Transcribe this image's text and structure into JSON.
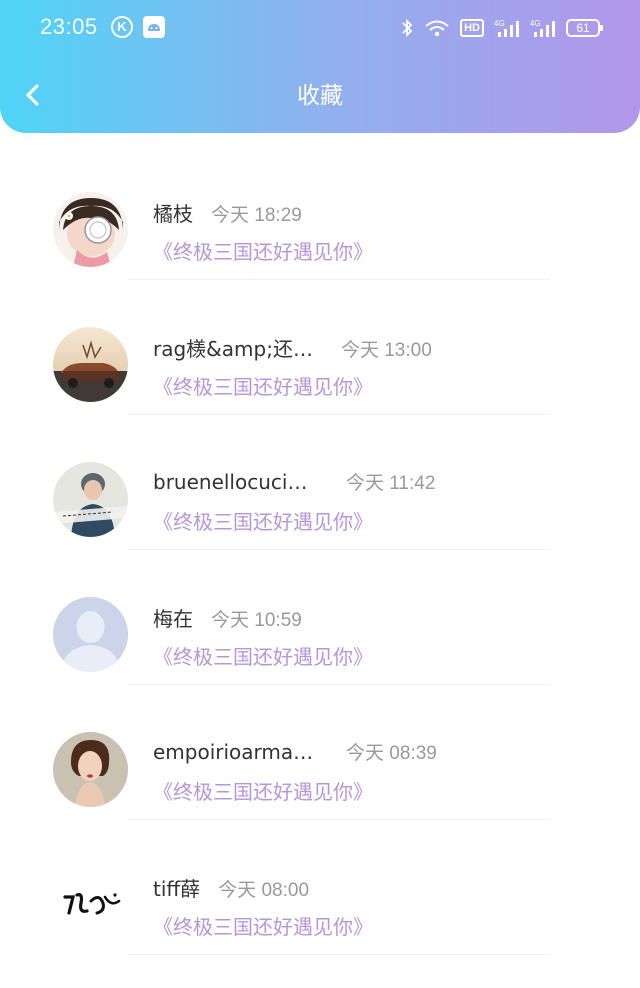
{
  "status_bar": {
    "time": "23:05",
    "k_badge": "K",
    "hd_label": "HD",
    "net1": "4G",
    "net2": "4G",
    "battery": "61"
  },
  "nav": {
    "title": "收藏",
    "back_icon": "chevron-left-icon"
  },
  "colors": {
    "header_gradient_start": "#4fd4f6",
    "header_gradient_end": "#b396ea",
    "book_link": "#b596dd",
    "time_text": "#999999",
    "username_text": "#333333"
  },
  "favorites": [
    {
      "username": "橘枝",
      "time": "今天 18:29",
      "book": "《终极三国还好遇见你》",
      "avatar": "cartoon-girl-avatar"
    },
    {
      "username": "rag檨&amp;还…",
      "time": "今天 13:00",
      "book": "《终极三国还好遇见你》",
      "avatar": "landscape-car-avatar"
    },
    {
      "username": "bruenellocucin…",
      "time": "今天 11:42",
      "book": "《终极三国还好遇见你》",
      "avatar": "boy-portrait-avatar"
    },
    {
      "username": "梅在",
      "time": "今天 10:59",
      "book": "《终极三国还好遇见你》",
      "avatar": "default-user-avatar"
    },
    {
      "username": "empoirioarman…",
      "time": "今天 08:39",
      "book": "《终极三国还好遇见你》",
      "avatar": "woman-portrait-avatar"
    },
    {
      "username": "tiff薛",
      "time": "今天 08:00",
      "book": "《终极三国还好遇见你》",
      "avatar": "calligraphy-avatar"
    }
  ]
}
